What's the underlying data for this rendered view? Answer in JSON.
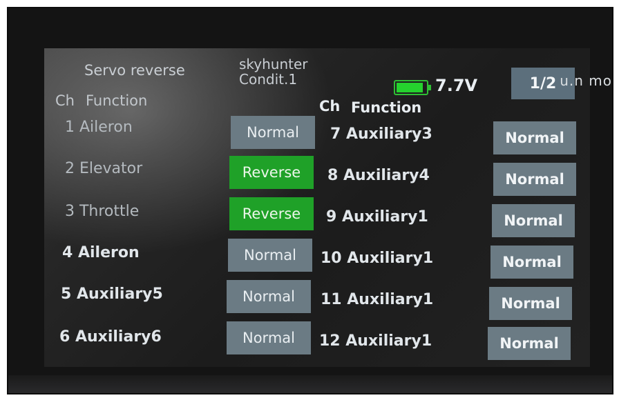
{
  "screen": {
    "title": "Servo reverse",
    "model_name": "skyhunter",
    "condition": "Condit.1",
    "voltage": "7.7V",
    "battery_level": 0.9,
    "page_indicator": "1/2"
  },
  "left_header": {
    "ch": "Ch",
    "function": "Function"
  },
  "right_header": {
    "ch": "Ch",
    "function": "Function"
  },
  "left_channels": [
    {
      "label": "1 Aileron",
      "value": "Normal",
      "state": "normal"
    },
    {
      "label": "2 Elevator",
      "value": "Reverse",
      "state": "reverse"
    },
    {
      "label": "3 Throttle",
      "value": "Reverse",
      "state": "reverse"
    },
    {
      "label": "4 Aileron",
      "value": "Normal",
      "state": "normal"
    },
    {
      "label": "5 Auxiliary5",
      "value": "Normal",
      "state": "normal"
    },
    {
      "label": "6 Auxiliary6",
      "value": "Normal",
      "state": "normal"
    }
  ],
  "right_channels": [
    {
      "label": "7 Auxiliary3",
      "value": "Normal",
      "state": "normal"
    },
    {
      "label": "8 Auxiliary4",
      "value": "Normal",
      "state": "normal"
    },
    {
      "label": "9 Auxiliary1",
      "value": "Normal",
      "state": "normal"
    },
    {
      "label": "10 Auxiliary1",
      "value": "Normal",
      "state": "normal"
    },
    {
      "label": "11 Auxiliary1",
      "value": "Normal",
      "state": "normal"
    },
    {
      "label": "12 Auxiliary1",
      "value": "Normal",
      "state": "normal"
    }
  ],
  "device_side_text": "u.n mo",
  "colors": {
    "normal_button": "#6b7b84",
    "reverse_button": "#1fa128",
    "battery": "#25d22e",
    "page_button": "#5c6f7c"
  }
}
